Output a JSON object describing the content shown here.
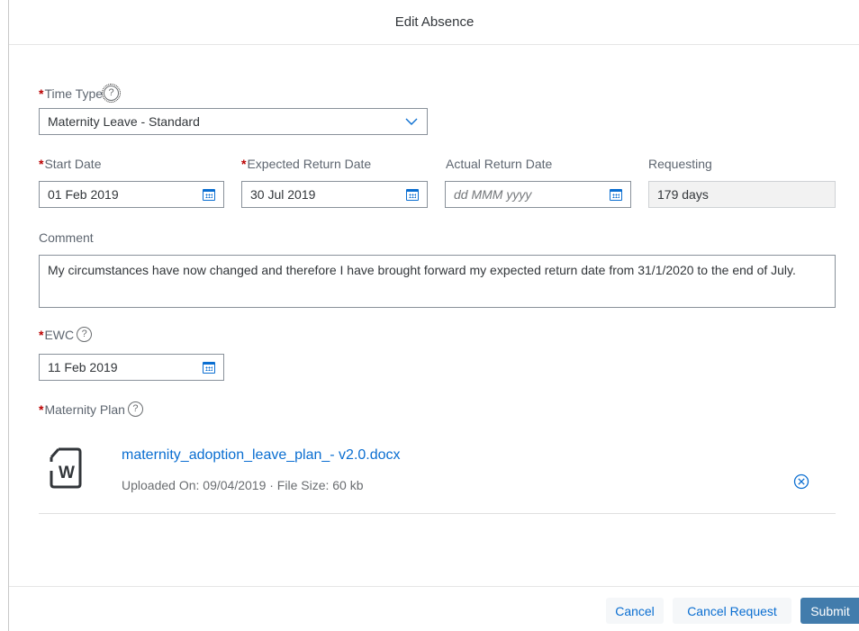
{
  "dialog": {
    "title": "Edit Absence"
  },
  "time_type": {
    "label": "Time Type",
    "required": "*",
    "help": "?",
    "value": "Maternity Leave - Standard"
  },
  "start_date": {
    "label": "Start Date",
    "required": "*",
    "value": "01 Feb 2019"
  },
  "expected_return": {
    "label": "Expected Return Date",
    "required": "*",
    "value": "30 Jul 2019"
  },
  "actual_return": {
    "label": "Actual Return Date",
    "placeholder": "dd MMM yyyy"
  },
  "requesting": {
    "label": "Requesting",
    "value": "179 days"
  },
  "comment": {
    "label": "Comment",
    "value": "My circumstances have now changed and therefore I have brought forward my expected return date from 31/1/2020 to the end of July."
  },
  "ewc": {
    "label": "EWC",
    "required": "*",
    "help": "?",
    "value": "11 Feb 2019"
  },
  "maternity_plan": {
    "label": "Maternity Plan",
    "required": "*",
    "help": "?",
    "file": {
      "icon": "word-document-icon",
      "icon_letter": "W",
      "name": "maternity_adoption_leave_plan_- v2.0.docx",
      "meta": "Uploaded On: 09/04/2019 · File Size: 60 kb"
    }
  },
  "footer": {
    "cancel": "Cancel",
    "cancel_request": "Cancel Request",
    "submit": "Submit"
  },
  "colors": {
    "accent": "#0a6ed1",
    "required": "#bb0000",
    "emphasized_button": "#427cac"
  }
}
